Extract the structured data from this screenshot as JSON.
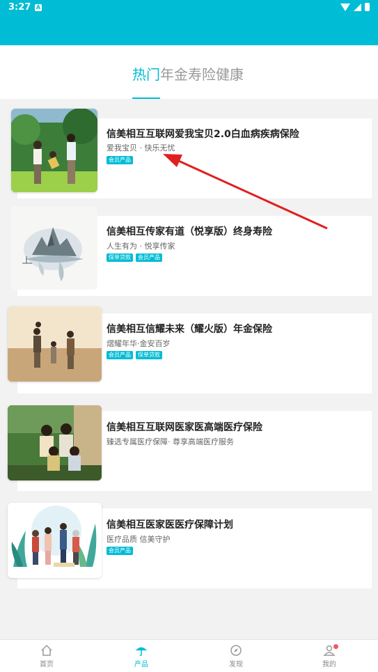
{
  "status_bar": {
    "time": "3:27",
    "badge": "A"
  },
  "category_tabs": [
    {
      "label": "热门",
      "active": true
    },
    {
      "label": "年金",
      "active": false
    },
    {
      "label": "寿险",
      "active": false
    },
    {
      "label": "健康",
      "active": false
    }
  ],
  "products": [
    {
      "title": "信美相互互联网爱我宝贝2.0白血病疾病保险",
      "subtitle": "爱我宝贝 · 快乐无忧",
      "tags": [
        "会员产品"
      ],
      "image_icon": "family-park-photo"
    },
    {
      "title": "信美相互传家有道（悦享版）终身寿险",
      "subtitle": "人生有为 · 悦享传家",
      "tags": [
        "保单贷款",
        "会员产品"
      ],
      "image_icon": "ink-landscape-painting"
    },
    {
      "title": "信美相互信耀未来（耀火版）年金保险",
      "subtitle": "熠耀年华·金安百岁",
      "tags": [
        "会员产品",
        "保单贷款"
      ],
      "image_icon": "family-beach-photo"
    },
    {
      "title": "信美相互互联网医家医高端医疗保险",
      "subtitle": "臻选专属医疗保障· 尊享高端医疗服务",
      "tags": [],
      "image_icon": "family-portrait-photo"
    },
    {
      "title": "信美相互医家医医疗保障计划",
      "subtitle": "医疗品质 信美守护",
      "tags": [
        "会员产品"
      ],
      "image_icon": "family-illustration"
    }
  ],
  "bottom_nav": [
    {
      "label": "首页",
      "icon": "home-icon",
      "active": false
    },
    {
      "label": "产品",
      "icon": "umbrella-icon",
      "active": true
    },
    {
      "label": "发现",
      "icon": "compass-icon",
      "active": false
    },
    {
      "label": "我的",
      "icon": "user-icon",
      "active": false,
      "badge_dot": true
    }
  ],
  "colors": {
    "accent": "#00bcd4",
    "tag_bg": "#00bcd4",
    "annotation_arrow": "#e02020",
    "notification_dot": "#f25a5a"
  }
}
